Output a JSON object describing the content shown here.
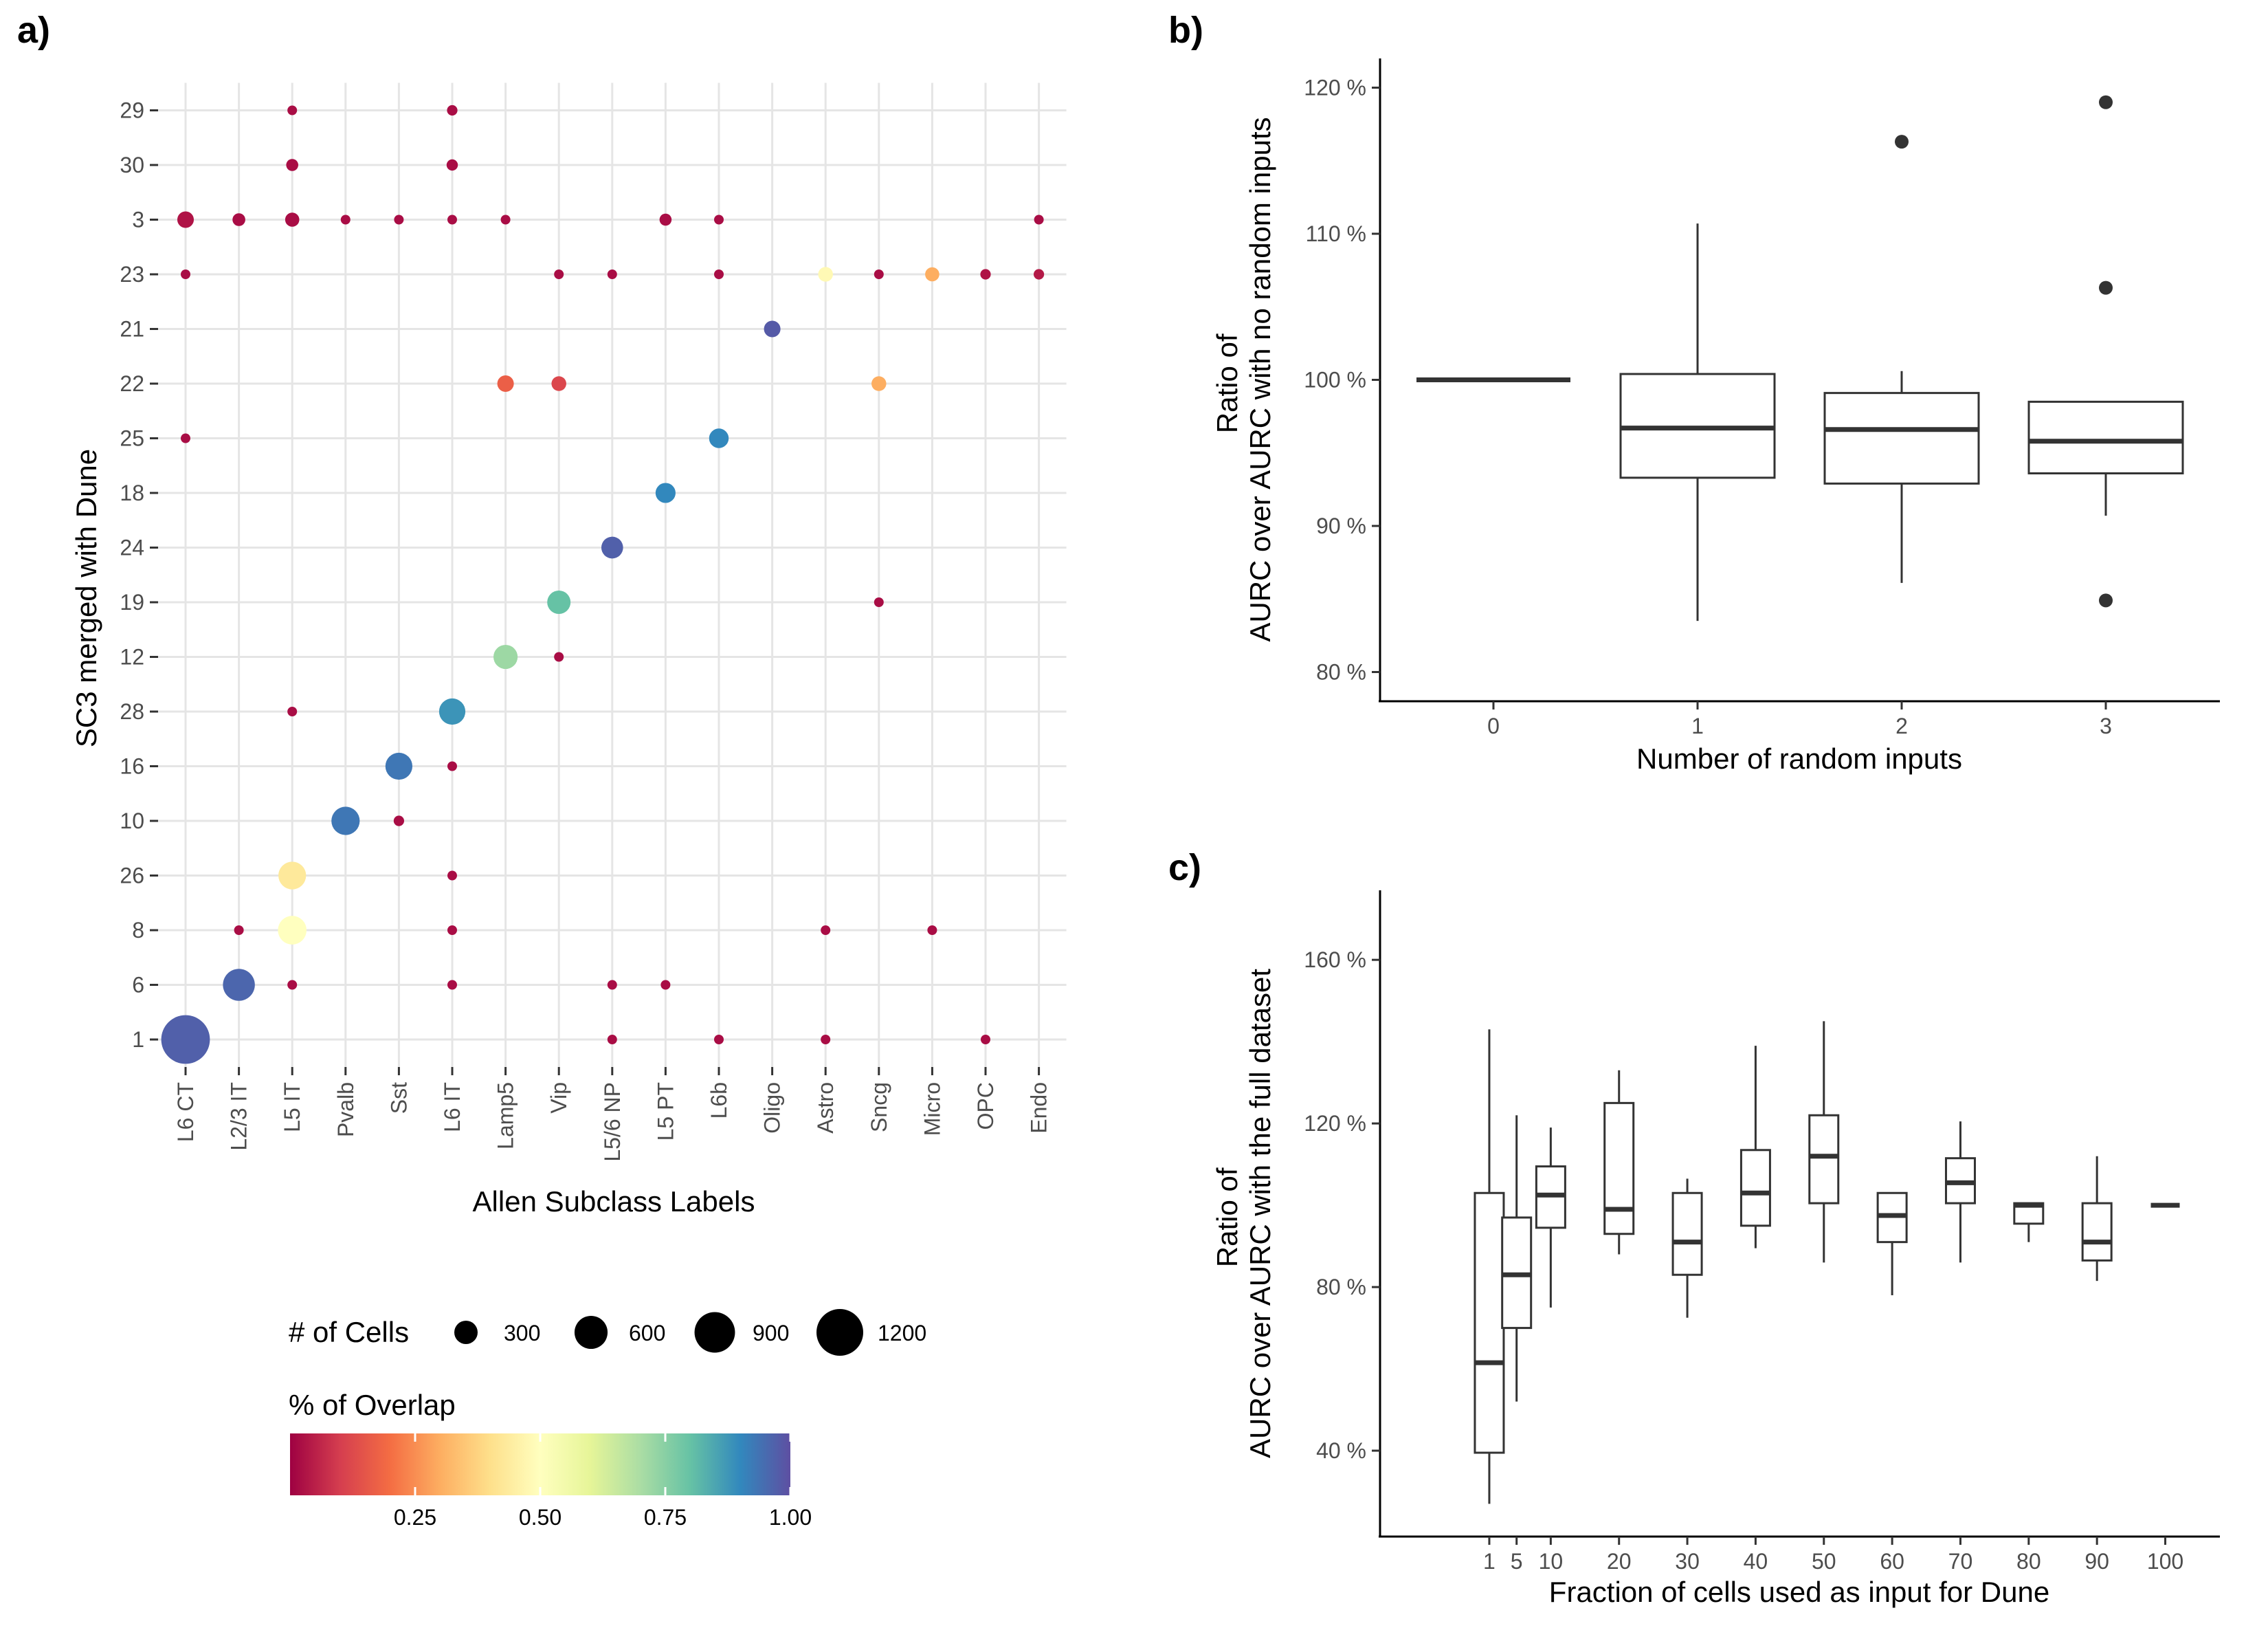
{
  "panel_labels": [
    "a)",
    "b)",
    "c)"
  ],
  "chart_data": [
    {
      "type": "scatter",
      "panel": "a)",
      "xlabel": "Allen Subclass Labels",
      "ylabel": "SC3 merged with Dune",
      "grid": true,
      "x_categories": [
        "L6 CT",
        "L2/3 IT",
        "L5 IT",
        "Pvalb",
        "Sst",
        "L6 IT",
        "Lamp5",
        "Vip",
        "L5/6 NP",
        "L5 PT",
        "L6b",
        "Oligo",
        "Astro",
        "Sncg",
        "Micro",
        "OPC",
        "Endo"
      ],
      "y_categories": [
        "1",
        "6",
        "8",
        "26",
        "10",
        "16",
        "28",
        "12",
        "19",
        "24",
        "18",
        "25",
        "22",
        "21",
        "23",
        "3",
        "30",
        "29"
      ],
      "size_legend": {
        "title": "# of Cells",
        "breaks": [
          300,
          600,
          900,
          1200
        ]
      },
      "color_legend": {
        "title": "% of Overlap",
        "breaks": [
          "0.25",
          "0.50",
          "0.75",
          "1.00"
        ],
        "min": 0,
        "max": 1
      },
      "points": [
        {
          "x": "L5 IT",
          "y": "29",
          "cells": 40,
          "overlap": 0.02
        },
        {
          "x": "L6 IT",
          "y": "29",
          "cells": 60,
          "overlap": 0.02
        },
        {
          "x": "L5 IT",
          "y": "30",
          "cells": 80,
          "overlap": 0.02
        },
        {
          "x": "L6 IT",
          "y": "30",
          "cells": 70,
          "overlap": 0.02
        },
        {
          "x": "L6 CT",
          "y": "3",
          "cells": 150,
          "overlap": 0.03
        },
        {
          "x": "L2/3 IT",
          "y": "3",
          "cells": 90,
          "overlap": 0.02
        },
        {
          "x": "L5 IT",
          "y": "3",
          "cells": 110,
          "overlap": 0.02
        },
        {
          "x": "Pvalb",
          "y": "3",
          "cells": 40,
          "overlap": 0.02
        },
        {
          "x": "Sst",
          "y": "3",
          "cells": 40,
          "overlap": 0.02
        },
        {
          "x": "L6 IT",
          "y": "3",
          "cells": 40,
          "overlap": 0.02
        },
        {
          "x": "Lamp5",
          "y": "3",
          "cells": 25,
          "overlap": 0.02
        },
        {
          "x": "L5 PT",
          "y": "3",
          "cells": 80,
          "overlap": 0.02
        },
        {
          "x": "L6b",
          "y": "3",
          "cells": 50,
          "overlap": 0.02
        },
        {
          "x": "Endo",
          "y": "3",
          "cells": 25,
          "overlap": 0.02
        },
        {
          "x": "L6 CT",
          "y": "23",
          "cells": 40,
          "overlap": 0.02
        },
        {
          "x": "Vip",
          "y": "23",
          "cells": 40,
          "overlap": 0.02
        },
        {
          "x": "L5/6 NP",
          "y": "23",
          "cells": 40,
          "overlap": 0.02
        },
        {
          "x": "L6b",
          "y": "23",
          "cells": 40,
          "overlap": 0.02
        },
        {
          "x": "Astro",
          "y": "23",
          "cells": 120,
          "overlap": 0.48
        },
        {
          "x": "Sncg",
          "y": "23",
          "cells": 30,
          "overlap": 0.02
        },
        {
          "x": "Micro",
          "y": "23",
          "cells": 110,
          "overlap": 0.3
        },
        {
          "x": "OPC",
          "y": "23",
          "cells": 60,
          "overlap": 0.03
        },
        {
          "x": "Endo",
          "y": "23",
          "cells": 60,
          "overlap": 0.04
        },
        {
          "x": "Oligo",
          "y": "21",
          "cells": 150,
          "overlap": 0.98
        },
        {
          "x": "Lamp5",
          "y": "22",
          "cells": 150,
          "overlap": 0.17
        },
        {
          "x": "Vip",
          "y": "22",
          "cells": 120,
          "overlap": 0.12
        },
        {
          "x": "Sncg",
          "y": "22",
          "cells": 120,
          "overlap": 0.3
        },
        {
          "x": "L6 CT",
          "y": "25",
          "cells": 30,
          "overlap": 0.02
        },
        {
          "x": "L6b",
          "y": "25",
          "cells": 210,
          "overlap": 0.9
        },
        {
          "x": "L5 PT",
          "y": "18",
          "cells": 220,
          "overlap": 0.9
        },
        {
          "x": "L5/6 NP",
          "y": "24",
          "cells": 260,
          "overlap": 0.97
        },
        {
          "x": "Vip",
          "y": "19",
          "cells": 300,
          "overlap": 0.8
        },
        {
          "x": "Sncg",
          "y": "19",
          "cells": 30,
          "overlap": 0.02
        },
        {
          "x": "Lamp5",
          "y": "12",
          "cells": 320,
          "overlap": 0.72
        },
        {
          "x": "Vip",
          "y": "12",
          "cells": 25,
          "overlap": 0.02
        },
        {
          "x": "L5 IT",
          "y": "28",
          "cells": 50,
          "overlap": 0.02
        },
        {
          "x": "L6 IT",
          "y": "28",
          "cells": 380,
          "overlap": 0.88
        },
        {
          "x": "Sst",
          "y": "16",
          "cells": 400,
          "overlap": 0.93
        },
        {
          "x": "L6 IT",
          "y": "16",
          "cells": 25,
          "overlap": 0.02
        },
        {
          "x": "Pvalb",
          "y": "10",
          "cells": 440,
          "overlap": 0.93
        },
        {
          "x": "Sst",
          "y": "10",
          "cells": 60,
          "overlap": 0.02
        },
        {
          "x": "L5 IT",
          "y": "26",
          "cells": 420,
          "overlap": 0.43
        },
        {
          "x": "L6 IT",
          "y": "26",
          "cells": 25,
          "overlap": 0.02
        },
        {
          "x": "L2/3 IT",
          "y": "8",
          "cells": 50,
          "overlap": 0.02
        },
        {
          "x": "L5 IT",
          "y": "8",
          "cells": 450,
          "overlap": 0.5
        },
        {
          "x": "L6 IT",
          "y": "8",
          "cells": 25,
          "overlap": 0.02
        },
        {
          "x": "Astro",
          "y": "8",
          "cells": 25,
          "overlap": 0.02
        },
        {
          "x": "Micro",
          "y": "8",
          "cells": 25,
          "overlap": 0.02
        },
        {
          "x": "L2/3 IT",
          "y": "6",
          "cells": 560,
          "overlap": 0.96
        },
        {
          "x": "L5 IT",
          "y": "6",
          "cells": 40,
          "overlap": 0.02
        },
        {
          "x": "L6 IT",
          "y": "6",
          "cells": 30,
          "overlap": 0.02
        },
        {
          "x": "L5/6 NP",
          "y": "6",
          "cells": 25,
          "overlap": 0.02
        },
        {
          "x": "L5 PT",
          "y": "6",
          "cells": 25,
          "overlap": 0.02
        },
        {
          "x": "L6 CT",
          "y": "1",
          "cells": 1300,
          "overlap": 0.97
        },
        {
          "x": "L5/6 NP",
          "y": "1",
          "cells": 30,
          "overlap": 0.02
        },
        {
          "x": "L6b",
          "y": "1",
          "cells": 40,
          "overlap": 0.02
        },
        {
          "x": "Astro",
          "y": "1",
          "cells": 30,
          "overlap": 0.02
        },
        {
          "x": "OPC",
          "y": "1",
          "cells": 30,
          "overlap": 0.02
        }
      ]
    },
    {
      "type": "box",
      "panel": "b)",
      "xlabel": "Number of random inputs",
      "ylabel": "Ratio of AURC over AURC with no random inputs",
      "ylim": [
        78,
        122
      ],
      "y_ticks": [
        "80 %",
        "90 %",
        "100 %",
        "110 %",
        "120 %"
      ],
      "groups": [
        {
          "label": "0",
          "min": 100,
          "q1": 100,
          "median": 100,
          "q3": 100,
          "max": 100,
          "outliers": []
        },
        {
          "label": "1",
          "min": 83.5,
          "q1": 93.3,
          "median": 96.7,
          "q3": 100.4,
          "max": 110.7,
          "outliers": []
        },
        {
          "label": "2",
          "min": 86.1,
          "q1": 92.9,
          "median": 96.6,
          "q3": 99.1,
          "max": 100.6,
          "outliers": [
            116.3
          ]
        },
        {
          "label": "3",
          "min": 90.7,
          "q1": 93.6,
          "median": 95.8,
          "q3": 98.5,
          "max": 98.5,
          "outliers": [
            119,
            106.3,
            84.9
          ]
        }
      ]
    },
    {
      "type": "box",
      "panel": "c)",
      "xlabel": "Fraction of cells used as input for Dune",
      "ylabel": "Ratio of AURC over AURC with the full dataset",
      "xlim": [
        -15,
        108
      ],
      "ylim": [
        19,
        177
      ],
      "y_ticks": [
        "40 %",
        "80 %",
        "120 %",
        "160 %"
      ],
      "groups": [
        {
          "label": "1",
          "x": 1,
          "min": 27,
          "q1": 39.5,
          "median": 61.5,
          "q3": 103,
          "max": 143
        },
        {
          "label": "5",
          "x": 5,
          "min": 52,
          "q1": 70,
          "median": 83,
          "q3": 97,
          "max": 122
        },
        {
          "label": "10",
          "x": 10,
          "min": 75,
          "q1": 94.5,
          "median": 102.5,
          "q3": 109.5,
          "max": 119
        },
        {
          "label": "20",
          "x": 20,
          "min": 88,
          "q1": 93,
          "median": 99,
          "q3": 125,
          "max": 133
        },
        {
          "label": "30",
          "x": 30,
          "min": 72.5,
          "q1": 83,
          "median": 91,
          "q3": 103,
          "max": 106.5
        },
        {
          "label": "40",
          "x": 40,
          "min": 89.5,
          "q1": 95,
          "median": 103,
          "q3": 113.5,
          "max": 139
        },
        {
          "label": "50",
          "x": 50,
          "min": 86,
          "q1": 100.5,
          "median": 112,
          "q3": 122,
          "max": 145
        },
        {
          "label": "60",
          "x": 60,
          "min": 78,
          "q1": 91,
          "median": 97.5,
          "q3": 103,
          "max": 103
        },
        {
          "label": "70",
          "x": 70,
          "min": 86,
          "q1": 100.5,
          "median": 105.5,
          "q3": 111.5,
          "max": 120.5
        },
        {
          "label": "80",
          "x": 80,
          "min": 91,
          "q1": 95.5,
          "median": 100,
          "q3": 100.5,
          "max": 100.5
        },
        {
          "label": "90",
          "x": 90,
          "min": 81.5,
          "q1": 86.5,
          "median": 91,
          "q3": 100.5,
          "max": 112
        },
        {
          "label": "100",
          "x": 100,
          "min": 100,
          "q1": 100,
          "median": 100,
          "q3": 100,
          "max": 100
        }
      ]
    }
  ]
}
